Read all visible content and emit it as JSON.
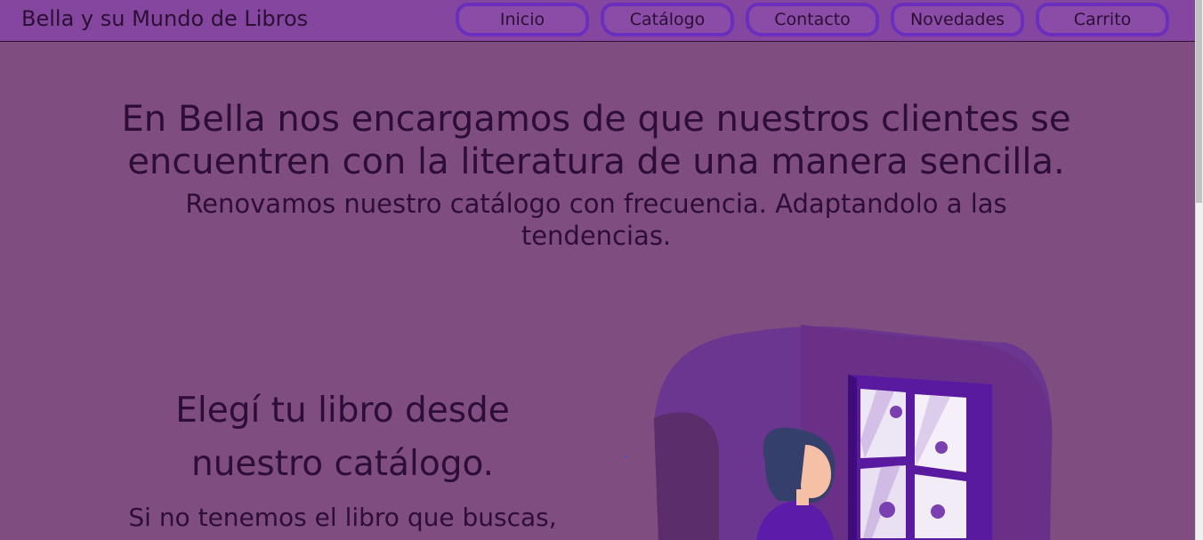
{
  "header": {
    "brand": "Bella y su Mundo de Libros",
    "nav": [
      "Inicio",
      "Catálogo",
      "Contacto",
      "Novedades",
      "Carrito"
    ]
  },
  "hero": {
    "title": "En Bella nos encargamos de que nuestros clientes se encuentren con la literatura de una manera sencilla.",
    "subtitle": "Renovamos nuestro catálogo con frecuencia. Adaptandolo a las tendencias."
  },
  "section": {
    "title": "Elegí tu libro desde nuestro catálogo.",
    "text": "Si no tenemos el libro que buscas,"
  },
  "colors": {
    "background": "#7f4d80",
    "header": "#8546a0",
    "nav_border": "#6a2fbc",
    "text": "#2d0e36"
  },
  "illustration": {
    "icon": "woman-at-window-illustration"
  }
}
